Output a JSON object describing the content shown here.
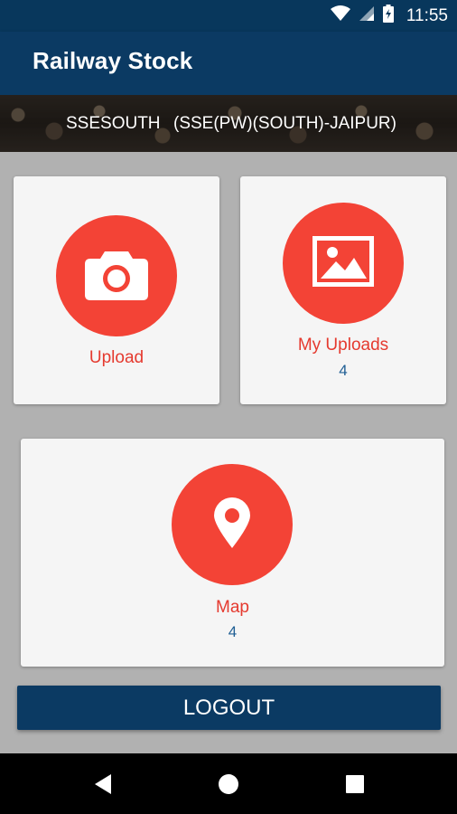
{
  "status_bar": {
    "time": "11:55",
    "icons": [
      "wifi-icon",
      "signal-icon",
      "battery-icon"
    ]
  },
  "app_bar": {
    "title": "Railway Stock"
  },
  "banner": {
    "user": "SSESOUTH",
    "office": "(SSE(PW)(SOUTH)-JAIPUR)"
  },
  "cards": {
    "upload": {
      "label": "Upload",
      "icon": "camera-icon"
    },
    "my_uploads": {
      "label": "My Uploads",
      "count": "4",
      "icon": "image-icon"
    },
    "map": {
      "label": "Map",
      "count": "4",
      "icon": "location-pin-icon"
    }
  },
  "logout": {
    "label": "LOGOUT"
  },
  "nav_bar": {
    "icons": [
      "back-icon",
      "home-icon",
      "recents-icon"
    ]
  },
  "colors": {
    "primary": "#0b3a63",
    "accent": "#f34336",
    "label_red": "#e53a2f",
    "count_blue": "#1f5e94"
  }
}
